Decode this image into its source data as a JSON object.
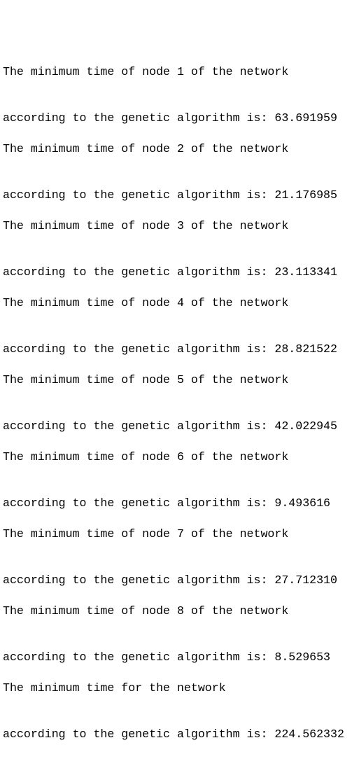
{
  "output": {
    "blocks": [
      {
        "line1": "The minimum time of node 1 of the network",
        "line2": "according to the genetic algorithm is: 63.691959"
      },
      {
        "line1": "The minimum time of node 2 of the network",
        "line2": "according to the genetic algorithm is: 21.176985"
      },
      {
        "line1": "The minimum time of node 3 of the network",
        "line2": "according to the genetic algorithm is: 23.113341"
      },
      {
        "line1": "The minimum time of node 4 of the network",
        "line2": "according to the genetic algorithm is: 28.821522"
      },
      {
        "line1": "The minimum time of node 5 of the network",
        "line2": "according to the genetic algorithm is: 42.022945"
      },
      {
        "line1": "The minimum time of node 6 of the network",
        "line2": "according to the genetic algorithm is: 9.493616"
      },
      {
        "line1": "The minimum time of node 7 of the network",
        "line2": "according to the genetic algorithm is: 27.712310"
      },
      {
        "line1": "The minimum time of node 8 of the network",
        "line2": "according to the genetic algorithm is: 8.529653"
      },
      {
        "line1": "The minimum time for the network",
        "line2": "according to the genetic algorithm is: 224.562332"
      }
    ]
  }
}
